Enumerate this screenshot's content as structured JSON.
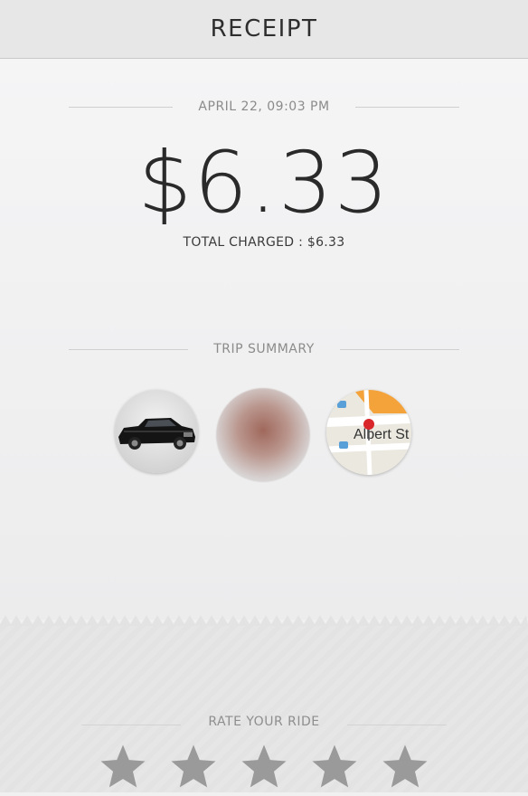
{
  "header": {
    "title": "RECEIPT"
  },
  "receipt": {
    "datetime": "APRIL 22, 09:03 PM",
    "amount": "$6.33",
    "total_charged": "TOTAL CHARGED : $6.33",
    "trip_summary_label": "TRIP SUMMARY",
    "map_street_label": "Albert St",
    "thumbnails": [
      "car-photo",
      "driver-photo",
      "map-thumbnail"
    ]
  },
  "rating": {
    "label": "RATE YOUR RIDE",
    "max_stars": 5,
    "selected_stars": 0
  },
  "colors": {
    "header_bg": "#e7e7e7",
    "star": "#9a9a9a",
    "map_accent": "#f4a23a",
    "pin": "#d9262b"
  }
}
